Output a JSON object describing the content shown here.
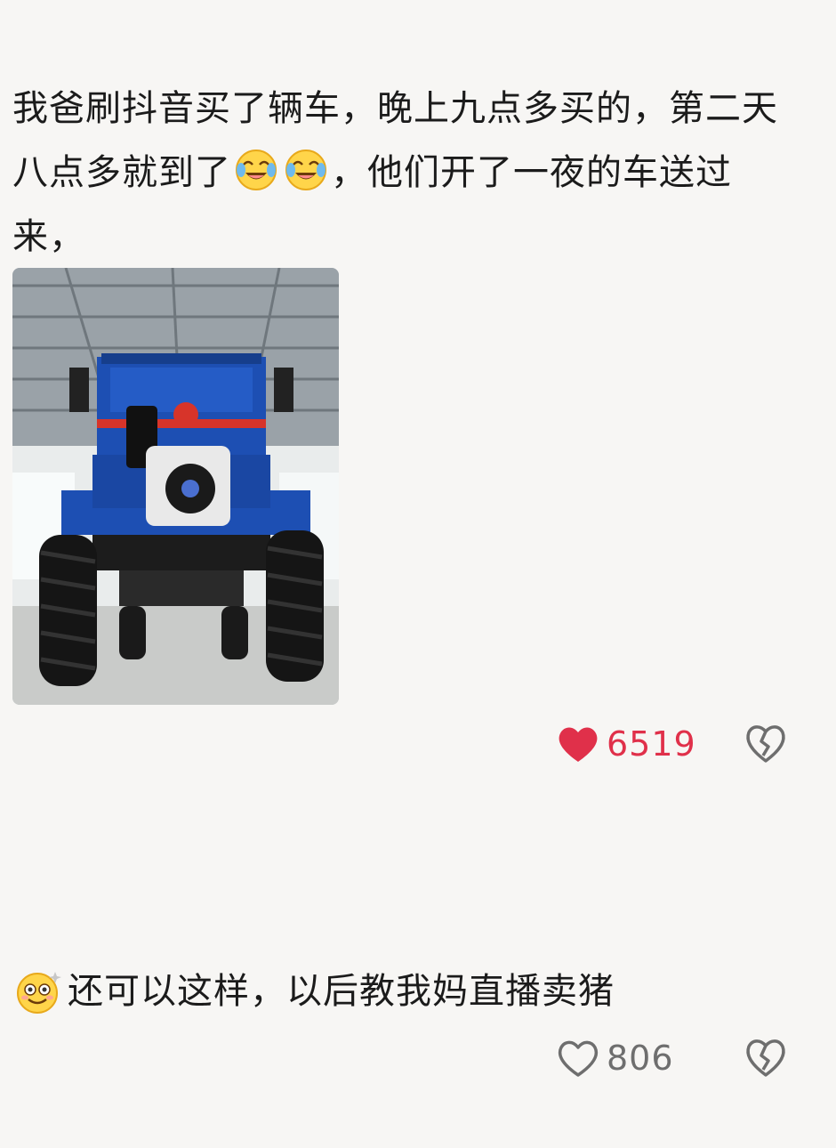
{
  "post": {
    "text_part1": "我爸刷抖音买了辆车，晚上九点多买的，第二天八点多就到了",
    "emoji_1": "crying-laughing-emoji",
    "emoji_2": "crying-laughing-emoji",
    "text_part2": "，他们开了一夜的车送过来，",
    "photo": "blue-tractor-photo",
    "likes": "6519",
    "liked": true
  },
  "reply": {
    "emoji": "dizzy-smile-emoji",
    "text": "还可以这样，以后教我妈直播卖猪",
    "likes": "806",
    "liked": false
  },
  "colors": {
    "background": "#f7f6f4",
    "like_active": "#e0304a",
    "like_inactive": "#6e6e6e",
    "text": "#1b1b1b",
    "tractor_blue": "#1d4fb3"
  },
  "icons": {
    "like_filled": "heart-filled-icon",
    "like_outline": "heart-outline-icon",
    "dislike": "broken-heart-icon"
  }
}
